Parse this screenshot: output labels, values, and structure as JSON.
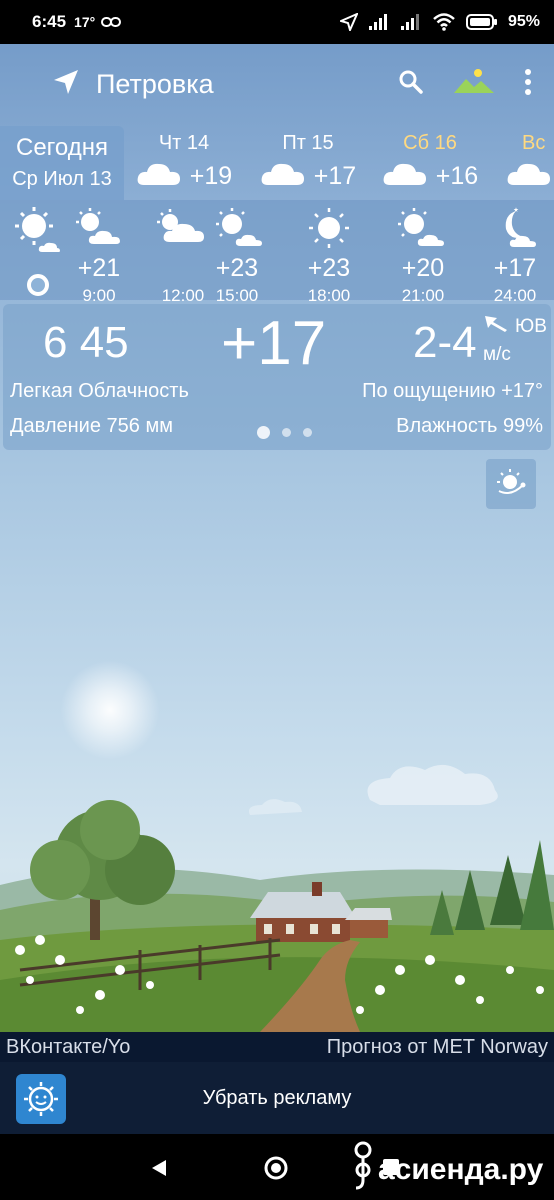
{
  "status_bar": {
    "time": "6:45",
    "temp_small": "17°",
    "battery": "95%"
  },
  "app_bar": {
    "city": "Петровка",
    "icons": [
      "location-arrow-icon",
      "search-icon",
      "landscape-icon",
      "more-vert-icon"
    ]
  },
  "days": {
    "today": {
      "label": "Сегодня",
      "date": "Ср Июл 13"
    },
    "list": [
      {
        "name": "Чт 14",
        "temp": "+19",
        "icon": "cloud-icon"
      },
      {
        "name": "Пт 15",
        "temp": "+17",
        "icon": "cloud-icon"
      },
      {
        "name": "Сб 16",
        "temp": "+16",
        "icon": "cloud-icon"
      },
      {
        "name": "Вс",
        "temp": "",
        "icon": "cloud-icon"
      }
    ],
    "saturday_color": "#ffd980"
  },
  "hourly": [
    {
      "time": "9:00",
      "temp": "+21",
      "icon": "partly-cloudy-icon"
    },
    {
      "time": "12:00",
      "temp": "",
      "icon": "sun-cloud-icon"
    },
    {
      "time": "15:00",
      "temp": "+23",
      "icon": "sun-cloud-icon"
    },
    {
      "time": "18:00",
      "temp": "+23",
      "icon": "sun-icon"
    },
    {
      "time": "21:00",
      "temp": "+20",
      "icon": "sun-cloud-icon"
    },
    {
      "time": "24:00",
      "temp": "+17",
      "icon": "moon-cloud-icon"
    }
  ],
  "current": {
    "time": "6 45",
    "temp": "+17",
    "wind_speed": "2-4",
    "wind_dir": "ЮВ",
    "wind_unit": "м/с",
    "condition": "Легкая Облачность",
    "feels_like": "По ощущению +17°",
    "pressure": "Давление 756 мм",
    "humidity": "Влажность 99%"
  },
  "footer": {
    "left_attrib": "ВКонтакте/Yo",
    "right_attrib": "Прогноз от MET Norway",
    "ad_label": "Убрать рекламу",
    "watermark": "асиенда.ру"
  },
  "colors": {
    "bar_dark": "#0a1830",
    "ad_bg": "#0f1e36",
    "accent_blue": "#2f86d0"
  }
}
